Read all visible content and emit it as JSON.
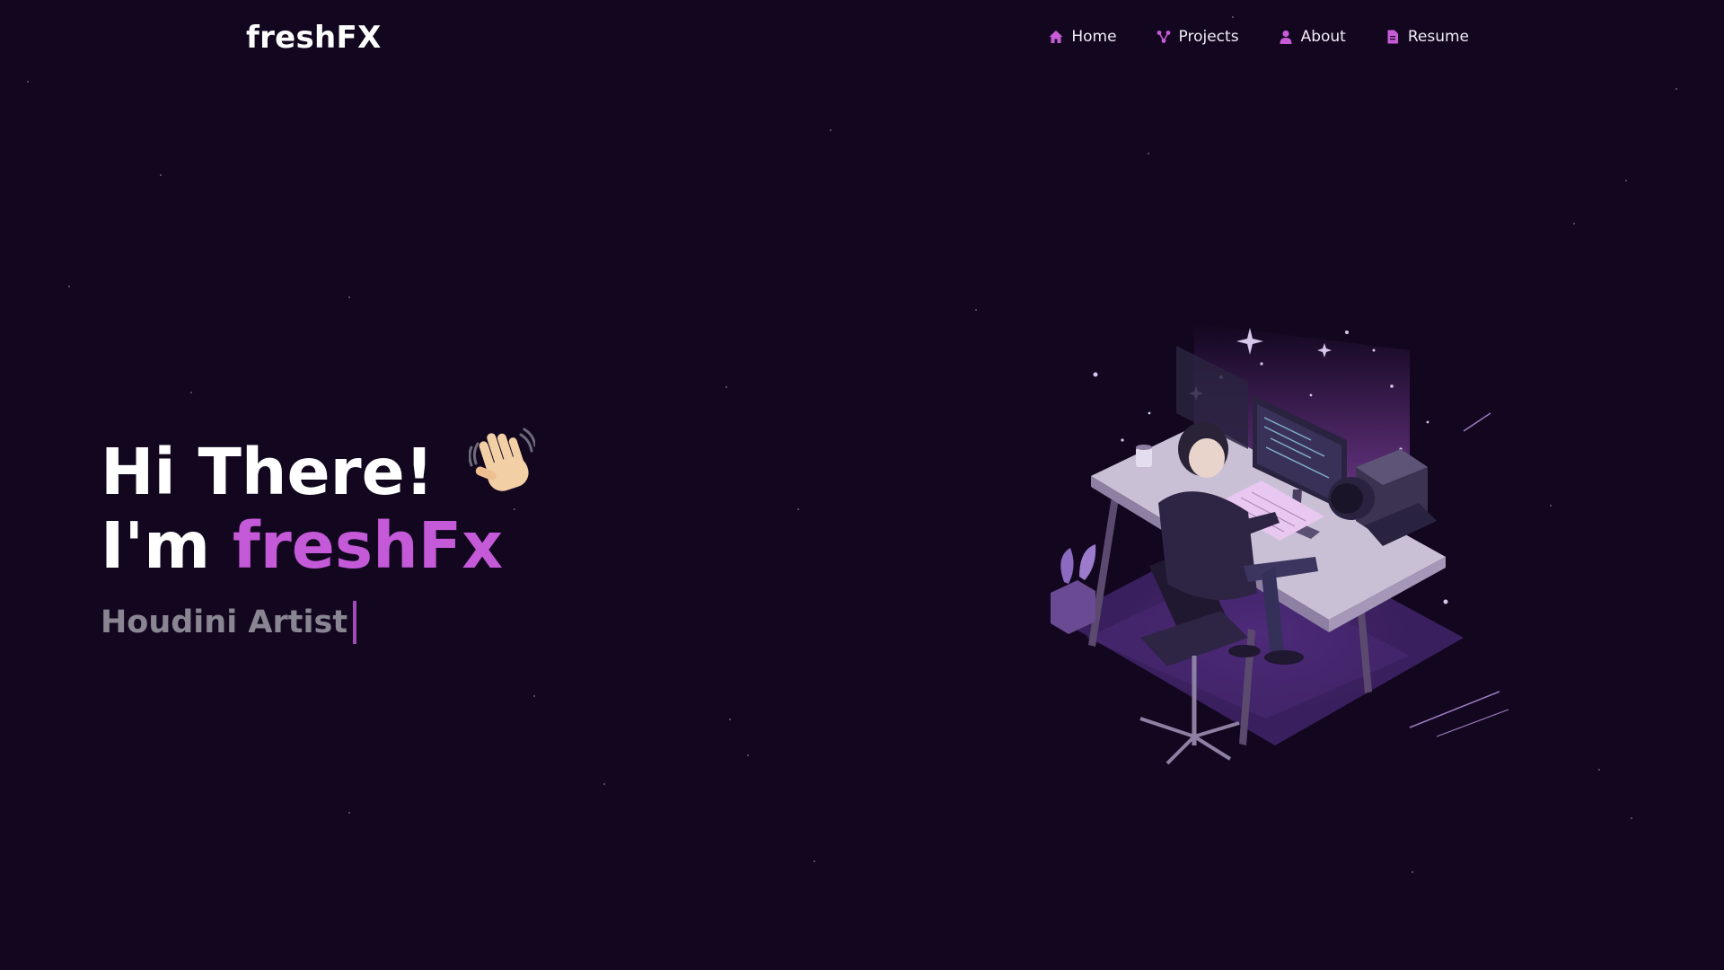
{
  "brand": {
    "logo": "freshFX"
  },
  "nav": {
    "items": [
      {
        "label": "Home",
        "icon": "home-icon"
      },
      {
        "label": "Projects",
        "icon": "projects-icon"
      },
      {
        "label": "About",
        "icon": "user-icon"
      },
      {
        "label": "Resume",
        "icon": "document-icon"
      }
    ]
  },
  "hero": {
    "greeting": "Hi There!",
    "intro_prefix": "I'm",
    "name": "freshFx",
    "role": "Houdini Artist"
  },
  "colors": {
    "background": "#12071f",
    "accent": "#c55ad9",
    "nav_icon": "#c75bd8",
    "role_text": "#8a8592"
  }
}
